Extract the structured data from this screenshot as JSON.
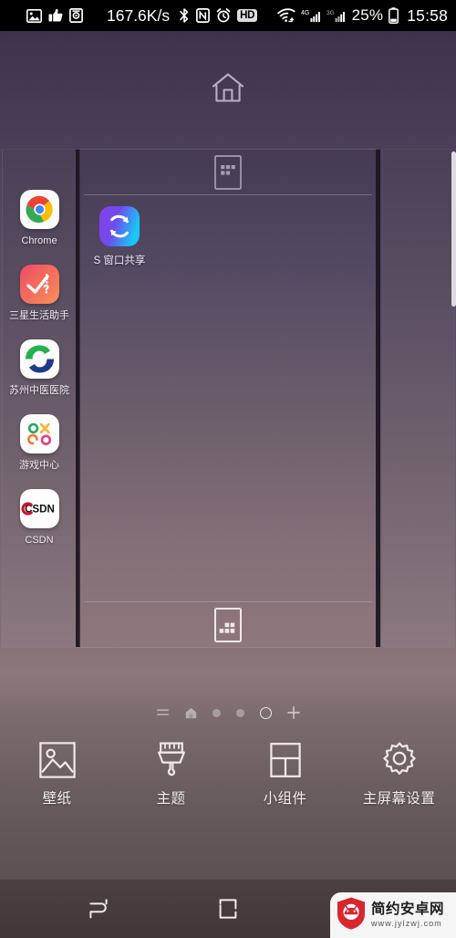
{
  "status_bar": {
    "left_icons": [
      {
        "name": "image-icon",
        "glyph": "image"
      },
      {
        "name": "thumbs-up-icon",
        "glyph": "thumb"
      },
      {
        "name": "screen-recorder-icon",
        "glyph": "recorder"
      }
    ],
    "network_speed": "167.6K/s",
    "indicator_icons": [
      {
        "name": "bluetooth-icon",
        "glyph": "bluetooth"
      },
      {
        "name": "nfc-icon",
        "glyph": "nfc"
      },
      {
        "name": "alarm-icon",
        "glyph": "alarm"
      }
    ],
    "hd_badge": "HD",
    "wifi": "wifi-icon",
    "signal_1_label": "4G",
    "signal_2_label": "3G",
    "battery_percent": "25%",
    "clock": "15:58"
  },
  "top_bar": {
    "home_button_name": "home-screen-button",
    "home_icon": "home-icon"
  },
  "previews": {
    "center_page": {
      "top_icon": "app-drawer-top-icon",
      "bottom_icon": "app-drawer-bottom-icon",
      "apps": [
        {
          "label": "S 窗口共享",
          "icon": "s-window-share-icon"
        }
      ]
    },
    "left_page": {
      "apps": [
        {
          "label": "Chrome",
          "icon": "chrome-icon"
        },
        {
          "label": "三星生活助手",
          "icon": "samsung-life-assistant-icon"
        },
        {
          "label": "苏州中医医院",
          "icon": "suzhou-tcm-hospital-icon"
        },
        {
          "label": "游戏中心",
          "icon": "game-center-icon"
        },
        {
          "label": "CSDN",
          "icon": "csdn-icon"
        }
      ]
    }
  },
  "page_indicators": {
    "items": [
      {
        "name": "page-indicator-list",
        "type": "list-icon"
      },
      {
        "name": "page-indicator-home",
        "type": "home-icon"
      },
      {
        "name": "page-indicator-dot-1",
        "type": "dot"
      },
      {
        "name": "page-indicator-dot-2",
        "type": "dot"
      },
      {
        "name": "page-indicator-current",
        "type": "ring"
      },
      {
        "name": "page-indicator-add",
        "type": "plus-icon"
      }
    ]
  },
  "bottom_menu": {
    "items": [
      {
        "label": "壁纸",
        "icon": "wallpaper-icon",
        "name": "menu-wallpaper"
      },
      {
        "label": "主题",
        "icon": "theme-brush-icon",
        "name": "menu-theme"
      },
      {
        "label": "小组件",
        "icon": "widgets-grid-icon",
        "name": "menu-widgets"
      },
      {
        "label": "主屏幕设置",
        "icon": "gear-icon",
        "name": "menu-home-settings"
      }
    ]
  },
  "nav_bar": {
    "recents": "recents-icon",
    "home": "home-square-icon",
    "back": "back-icon"
  },
  "watermark": {
    "site_name": "简约安卓网",
    "url": "www.jylzwj.com",
    "logo": "android-shield-logo"
  },
  "colors": {
    "status_bar_bg": "#000000",
    "page_gradient_top": "#3b2f49",
    "page_gradient_bottom": "#4f4547",
    "accent_selected": "#ffffff",
    "nav_bar_bg": "#453b3d",
    "watermark_red": "#d32f2f"
  }
}
